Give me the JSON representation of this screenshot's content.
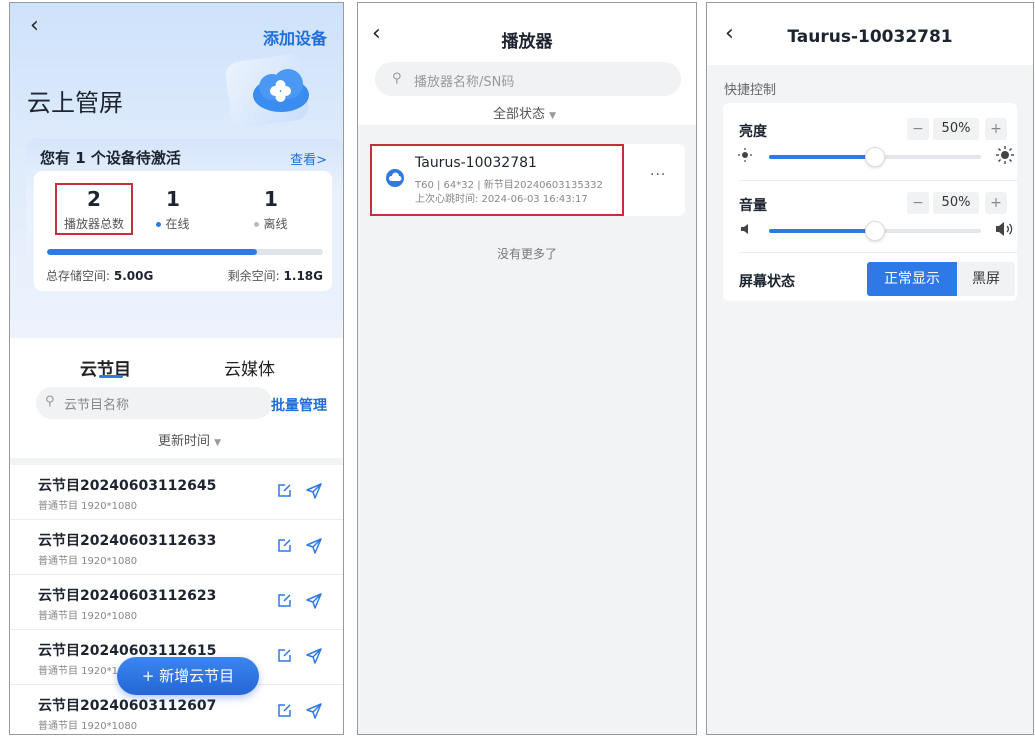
{
  "panel1": {
    "back_icon": "chevron-left-icon",
    "add_device": "添加设备",
    "title": "云上管屏",
    "activate_notice": "您有 1 个设备待激活",
    "view_link": "查看>",
    "stats": [
      {
        "value": "2",
        "label": "播放器总数"
      },
      {
        "value": "1",
        "label": "在线"
      },
      {
        "value": "1",
        "label": "离线"
      }
    ],
    "storage_used_fraction": 0.76,
    "storage_total_label": "总存储空间: ",
    "storage_total_value": "5.00G",
    "storage_free_label": "剩余空间: ",
    "storage_free_value": "1.18G",
    "tabs": [
      "云节目",
      "云媒体"
    ],
    "search_placeholder": "云节目名称",
    "batch_manage": "批量管理",
    "sort_label": "更新时间",
    "programs": [
      {
        "name": "云节目20240603112645",
        "meta": "普通节目  1920*1080"
      },
      {
        "name": "云节目20240603112633",
        "meta": "普通节目  1920*1080"
      },
      {
        "name": "云节目20240603112623",
        "meta": "普通节目  1920*1080"
      },
      {
        "name": "云节目20240603112615",
        "meta": "普通节目  1920*1080"
      },
      {
        "name": "云节目20240603112607",
        "meta": "普通节目  1920*1080"
      }
    ],
    "fab_label": "+ 新增云节目",
    "colors": {
      "accent": "#2f79e6",
      "highlight": "#c0313a"
    }
  },
  "panel2": {
    "title": "播放器",
    "search_placeholder": "播放器名称/SN码",
    "status_filter": "全部状态",
    "device": {
      "name": "Taurus-10032781",
      "meta1": "T60  |  64*32  |  新节目20240603135332",
      "meta2": "上次心跳时间: 2024-06-03 16:43:17",
      "more": "···"
    },
    "no_more": "没有更多了"
  },
  "panel3": {
    "title": "Taurus-10032781",
    "quick_control": "快捷控制",
    "brightness": {
      "label": "亮度",
      "value": "50%",
      "level": 0.5,
      "minus": "−",
      "plus": "+"
    },
    "volume": {
      "label": "音量",
      "value": "50%",
      "level": 0.5,
      "minus": "−",
      "plus": "+"
    },
    "screen_status": "屏幕状态",
    "screen_options": [
      "正常显示",
      "黑屏"
    ]
  }
}
